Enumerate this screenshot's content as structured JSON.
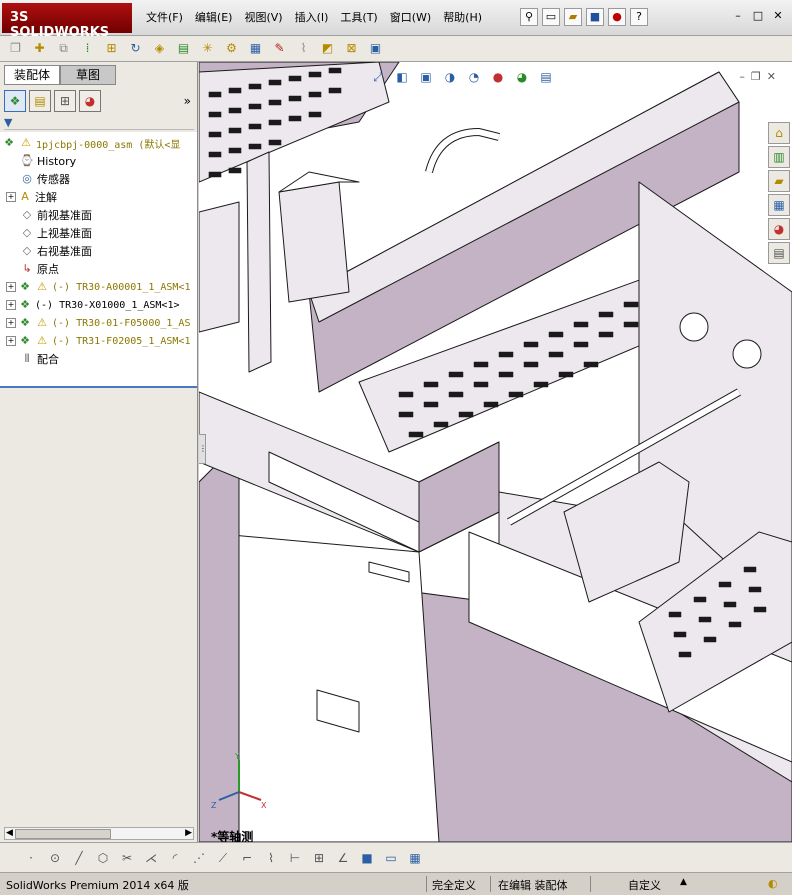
{
  "app": {
    "logo_text": "SOLIDWORKS",
    "logo_prefix": "3S"
  },
  "menu": [
    {
      "label": "文件(F)"
    },
    {
      "label": "编辑(E)"
    },
    {
      "label": "视图(V)"
    },
    {
      "label": "插入(I)"
    },
    {
      "label": "工具(T)"
    },
    {
      "label": "窗口(W)"
    },
    {
      "label": "帮助(H)"
    }
  ],
  "top_icons": [
    "pin-icon",
    "new-document-icon",
    "open-icon",
    "save-icon",
    "traffic-light-icon",
    "help-icon"
  ],
  "window_buttons": {
    "minimize": "–",
    "restore": "□",
    "close": "✕"
  },
  "left_panel": {
    "tabs": [
      {
        "label": "装配体",
        "active": true
      },
      {
        "label": "草图",
        "active": false
      }
    ],
    "more_label": "»",
    "tree": [
      {
        "label": "1pjcbpj-0000_asm  (默认<显",
        "icon": "assembly-icon",
        "warning": true,
        "expand": "-",
        "style": "olive"
      },
      {
        "label": "History",
        "icon": "history-icon",
        "expand": "",
        "style": "normal"
      },
      {
        "label": "传感器",
        "icon": "sensor-icon",
        "expand": "",
        "style": "normal"
      },
      {
        "label": "注解",
        "icon": "annotation-icon",
        "expand": "+",
        "style": "normal"
      },
      {
        "label": "前视基准面",
        "icon": "plane-icon",
        "expand": "",
        "style": "normal"
      },
      {
        "label": "上视基准面",
        "icon": "plane-icon",
        "expand": "",
        "style": "normal"
      },
      {
        "label": "右视基准面",
        "icon": "plane-icon",
        "expand": "",
        "style": "normal"
      },
      {
        "label": "原点",
        "icon": "origin-icon",
        "expand": "",
        "style": "normal"
      },
      {
        "label": "(-) TR30-A00001_1_ASM<1",
        "icon": "assembly-icon",
        "warning": true,
        "expand": "+",
        "style": "olive"
      },
      {
        "label": "(-) TR30-X01000_1_ASM<1>",
        "icon": "assembly-icon",
        "warning": false,
        "expand": "+",
        "style": "plain"
      },
      {
        "label": "(-) TR30-01-F05000_1_AS",
        "icon": "assembly-icon",
        "warning": true,
        "expand": "+",
        "style": "olive"
      },
      {
        "label": "(-) TR31-F02005_1_ASM<1",
        "icon": "assembly-icon",
        "warning": true,
        "expand": "+",
        "style": "olive"
      },
      {
        "label": "配合",
        "icon": "mates-icon",
        "expand": "",
        "style": "normal"
      }
    ]
  },
  "viewport": {
    "view_name": "*等轴测",
    "triad_axes": {
      "x": "X",
      "y": "Y",
      "z": "Z"
    }
  },
  "status_bar": {
    "product": "SolidWorks Premium 2014 x64 版",
    "definition": "完全定义",
    "editing": "在编辑 装配体",
    "units": "自定义",
    "arrow": "▲"
  },
  "colors": {
    "part_shade": "#c3b3c4",
    "part_light": "#ede8ee",
    "edge": "#1a1a1a",
    "tree_selection_bar": "#4a78c0",
    "logo": "#9a0e0e"
  }
}
